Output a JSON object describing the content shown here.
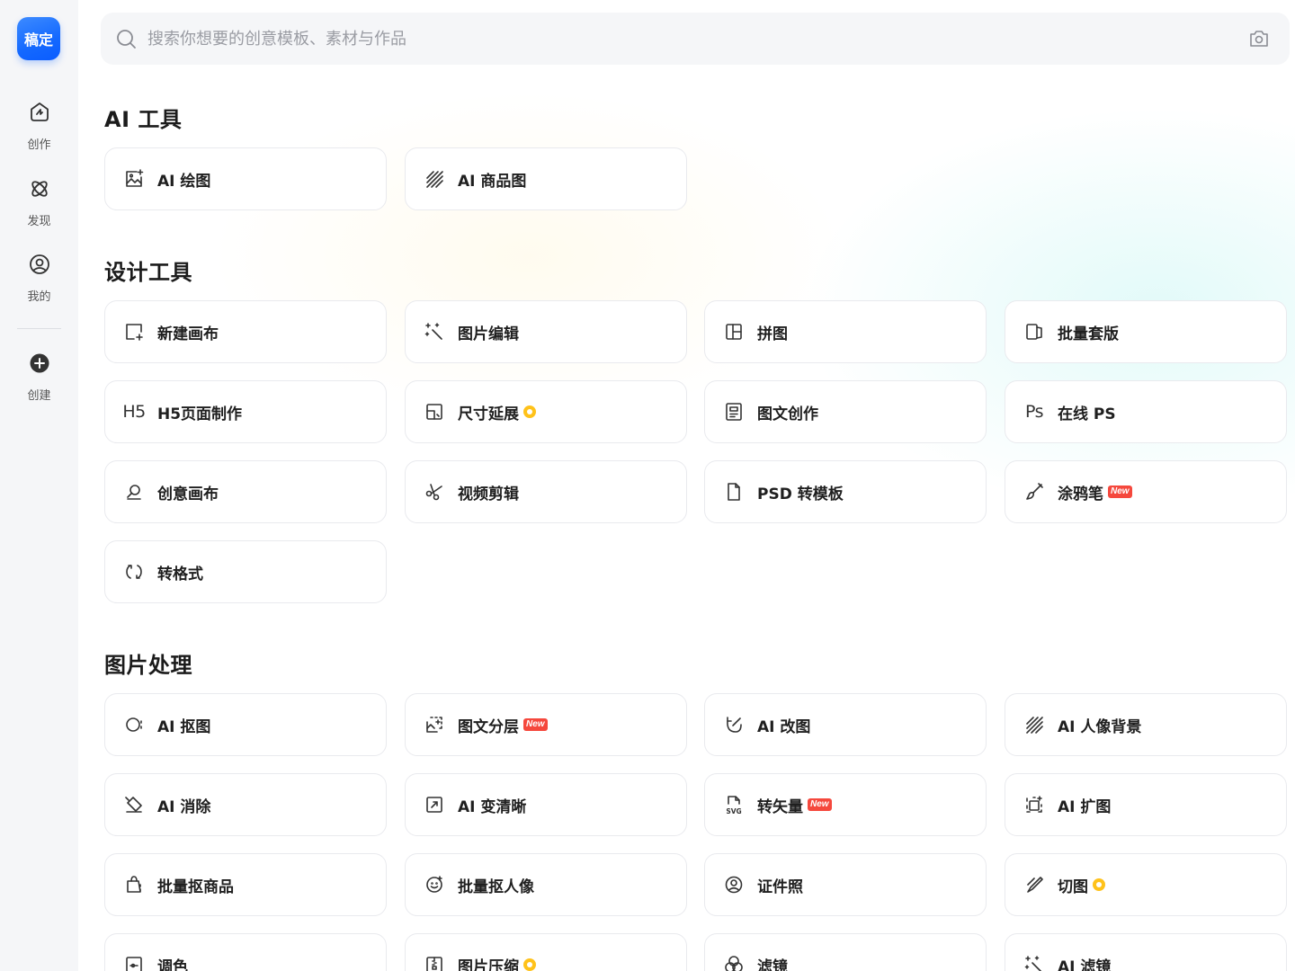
{
  "app": {
    "logo_text": "稿定"
  },
  "sidebar": {
    "items": [
      {
        "label": "创作",
        "icon": "create-icon"
      },
      {
        "label": "发现",
        "icon": "discover-icon"
      },
      {
        "label": "我的",
        "icon": "profile-icon"
      },
      {
        "label": "创建",
        "icon": "add-circle-icon"
      }
    ]
  },
  "search": {
    "placeholder": "搜索你想要的创意模板、素材与作品"
  },
  "sections": [
    {
      "title": "AI 工具",
      "tools": [
        {
          "label": "AI 绘图",
          "icon": "ai-drawing-icon"
        },
        {
          "label": "AI 商品图",
          "icon": "ai-product-image-icon"
        }
      ]
    },
    {
      "title": "设计工具",
      "tools": [
        {
          "label": "新建画布",
          "icon": "new-canvas-icon"
        },
        {
          "label": "图片编辑",
          "icon": "image-edit-icon"
        },
        {
          "label": "拼图",
          "icon": "collage-icon"
        },
        {
          "label": "批量套版",
          "icon": "batch-template-icon"
        },
        {
          "label": "H5页面制作",
          "icon": "h5-icon",
          "icon_text": "H5"
        },
        {
          "label": "尺寸延展",
          "icon": "resize-icon",
          "badge": "vip"
        },
        {
          "label": "图文创作",
          "icon": "text-image-icon"
        },
        {
          "label": "在线 PS",
          "icon": "ps-icon",
          "icon_text": "Ps"
        },
        {
          "label": "创意画布",
          "icon": "creative-canvas-icon"
        },
        {
          "label": "视频剪辑",
          "icon": "video-cut-icon"
        },
        {
          "label": "PSD 转模板",
          "icon": "psd-file-icon"
        },
        {
          "label": "涂鸦笔",
          "icon": "brush-icon",
          "badge": "New"
        },
        {
          "label": "转格式",
          "icon": "convert-format-icon"
        }
      ]
    },
    {
      "title": "图片处理",
      "tools": [
        {
          "label": "AI 抠图",
          "icon": "ai-cutout-icon"
        },
        {
          "label": "图文分层",
          "icon": "layer-split-icon",
          "badge": "New"
        },
        {
          "label": "AI 改图",
          "icon": "ai-modify-icon"
        },
        {
          "label": "AI 人像背景",
          "icon": "ai-portrait-bg-icon"
        },
        {
          "label": "AI 消除",
          "icon": "ai-erase-icon"
        },
        {
          "label": "AI 变清晰",
          "icon": "ai-sharpen-icon"
        },
        {
          "label": "转矢量",
          "icon": "svg-icon",
          "badge": "New"
        },
        {
          "label": "AI 扩图",
          "icon": "ai-expand-icon"
        },
        {
          "label": "批量抠商品",
          "icon": "batch-product-icon"
        },
        {
          "label": "批量抠人像",
          "icon": "batch-portrait-icon"
        },
        {
          "label": "证件照",
          "icon": "id-photo-icon"
        },
        {
          "label": "切图",
          "icon": "slice-icon",
          "badge": "vip"
        },
        {
          "label": "调色",
          "icon": "color-adjust-icon"
        },
        {
          "label": "图片压缩",
          "icon": "compress-icon",
          "badge": "vip"
        },
        {
          "label": "滤镜",
          "icon": "filter-icon"
        },
        {
          "label": "AI 滤镜",
          "icon": "ai-filter-icon"
        }
      ]
    }
  ],
  "colors": {
    "accent": "#1469ff",
    "new_badge": "#f5483d",
    "vip_badge": "#ffc21a"
  }
}
